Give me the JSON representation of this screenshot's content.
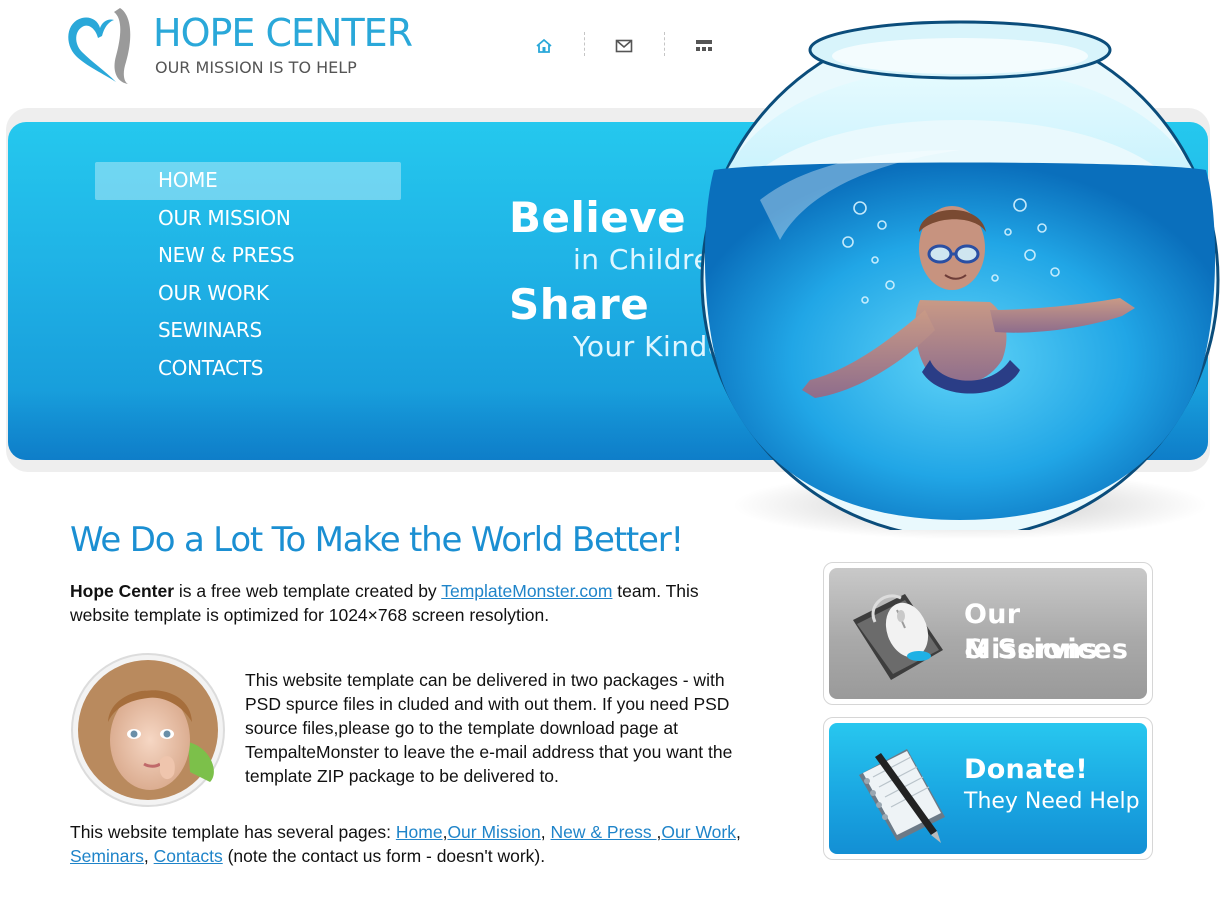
{
  "logo": {
    "title": "HOPE CENTER",
    "tagline": "OUR MISSION IS TO HELP"
  },
  "top_icons": [
    {
      "name": "home-icon"
    },
    {
      "name": "mail-icon"
    },
    {
      "name": "sitemap-icon"
    }
  ],
  "nav": {
    "items": [
      {
        "label": "HOME",
        "active": true
      },
      {
        "label": "OUR MISSION"
      },
      {
        "label": "NEW & PRESS"
      },
      {
        "label": "OUR WORK"
      },
      {
        "label": "SEWINARS"
      },
      {
        "label": "CONTACTS"
      }
    ]
  },
  "hero": {
    "line1": "Believe",
    "line2": "in Children!",
    "line3": "Share",
    "line4": "Your Kindess"
  },
  "content": {
    "headline": "We Do a Lot To Make the World Better!",
    "p1_bold": "Hope Center",
    "p1_a": " is a free web template created by ",
    "p1_link": "TemplateMonster.com",
    "p1_b": " team. This website template is optimized for 1024×768 screen resolytion.",
    "p2": "This website template can be delivered in two packages - with PSD spurce files in cluded and with out them. If you need PSD source files,please go to the template download page at TempalteMonster to leave the e-mail address that you want the template ZIP package to be delivered to.",
    "p3_a": "This website template has several pages: ",
    "p3_links": [
      "Home",
      "Our Mission",
      "New & Press ",
      "Our Work",
      "Seminars",
      "Contacts"
    ],
    "p3_b": " (note the contact us form - doesn't work)."
  },
  "boxes": {
    "missions": {
      "line1": "Our Missions",
      "line2": "& Services"
    },
    "donate": {
      "title": "Donate!",
      "sub": "They Need Help"
    }
  },
  "colors": {
    "accent": "#1b8fd2",
    "hero": "#1fb1e5",
    "link": "#1f84c9"
  }
}
